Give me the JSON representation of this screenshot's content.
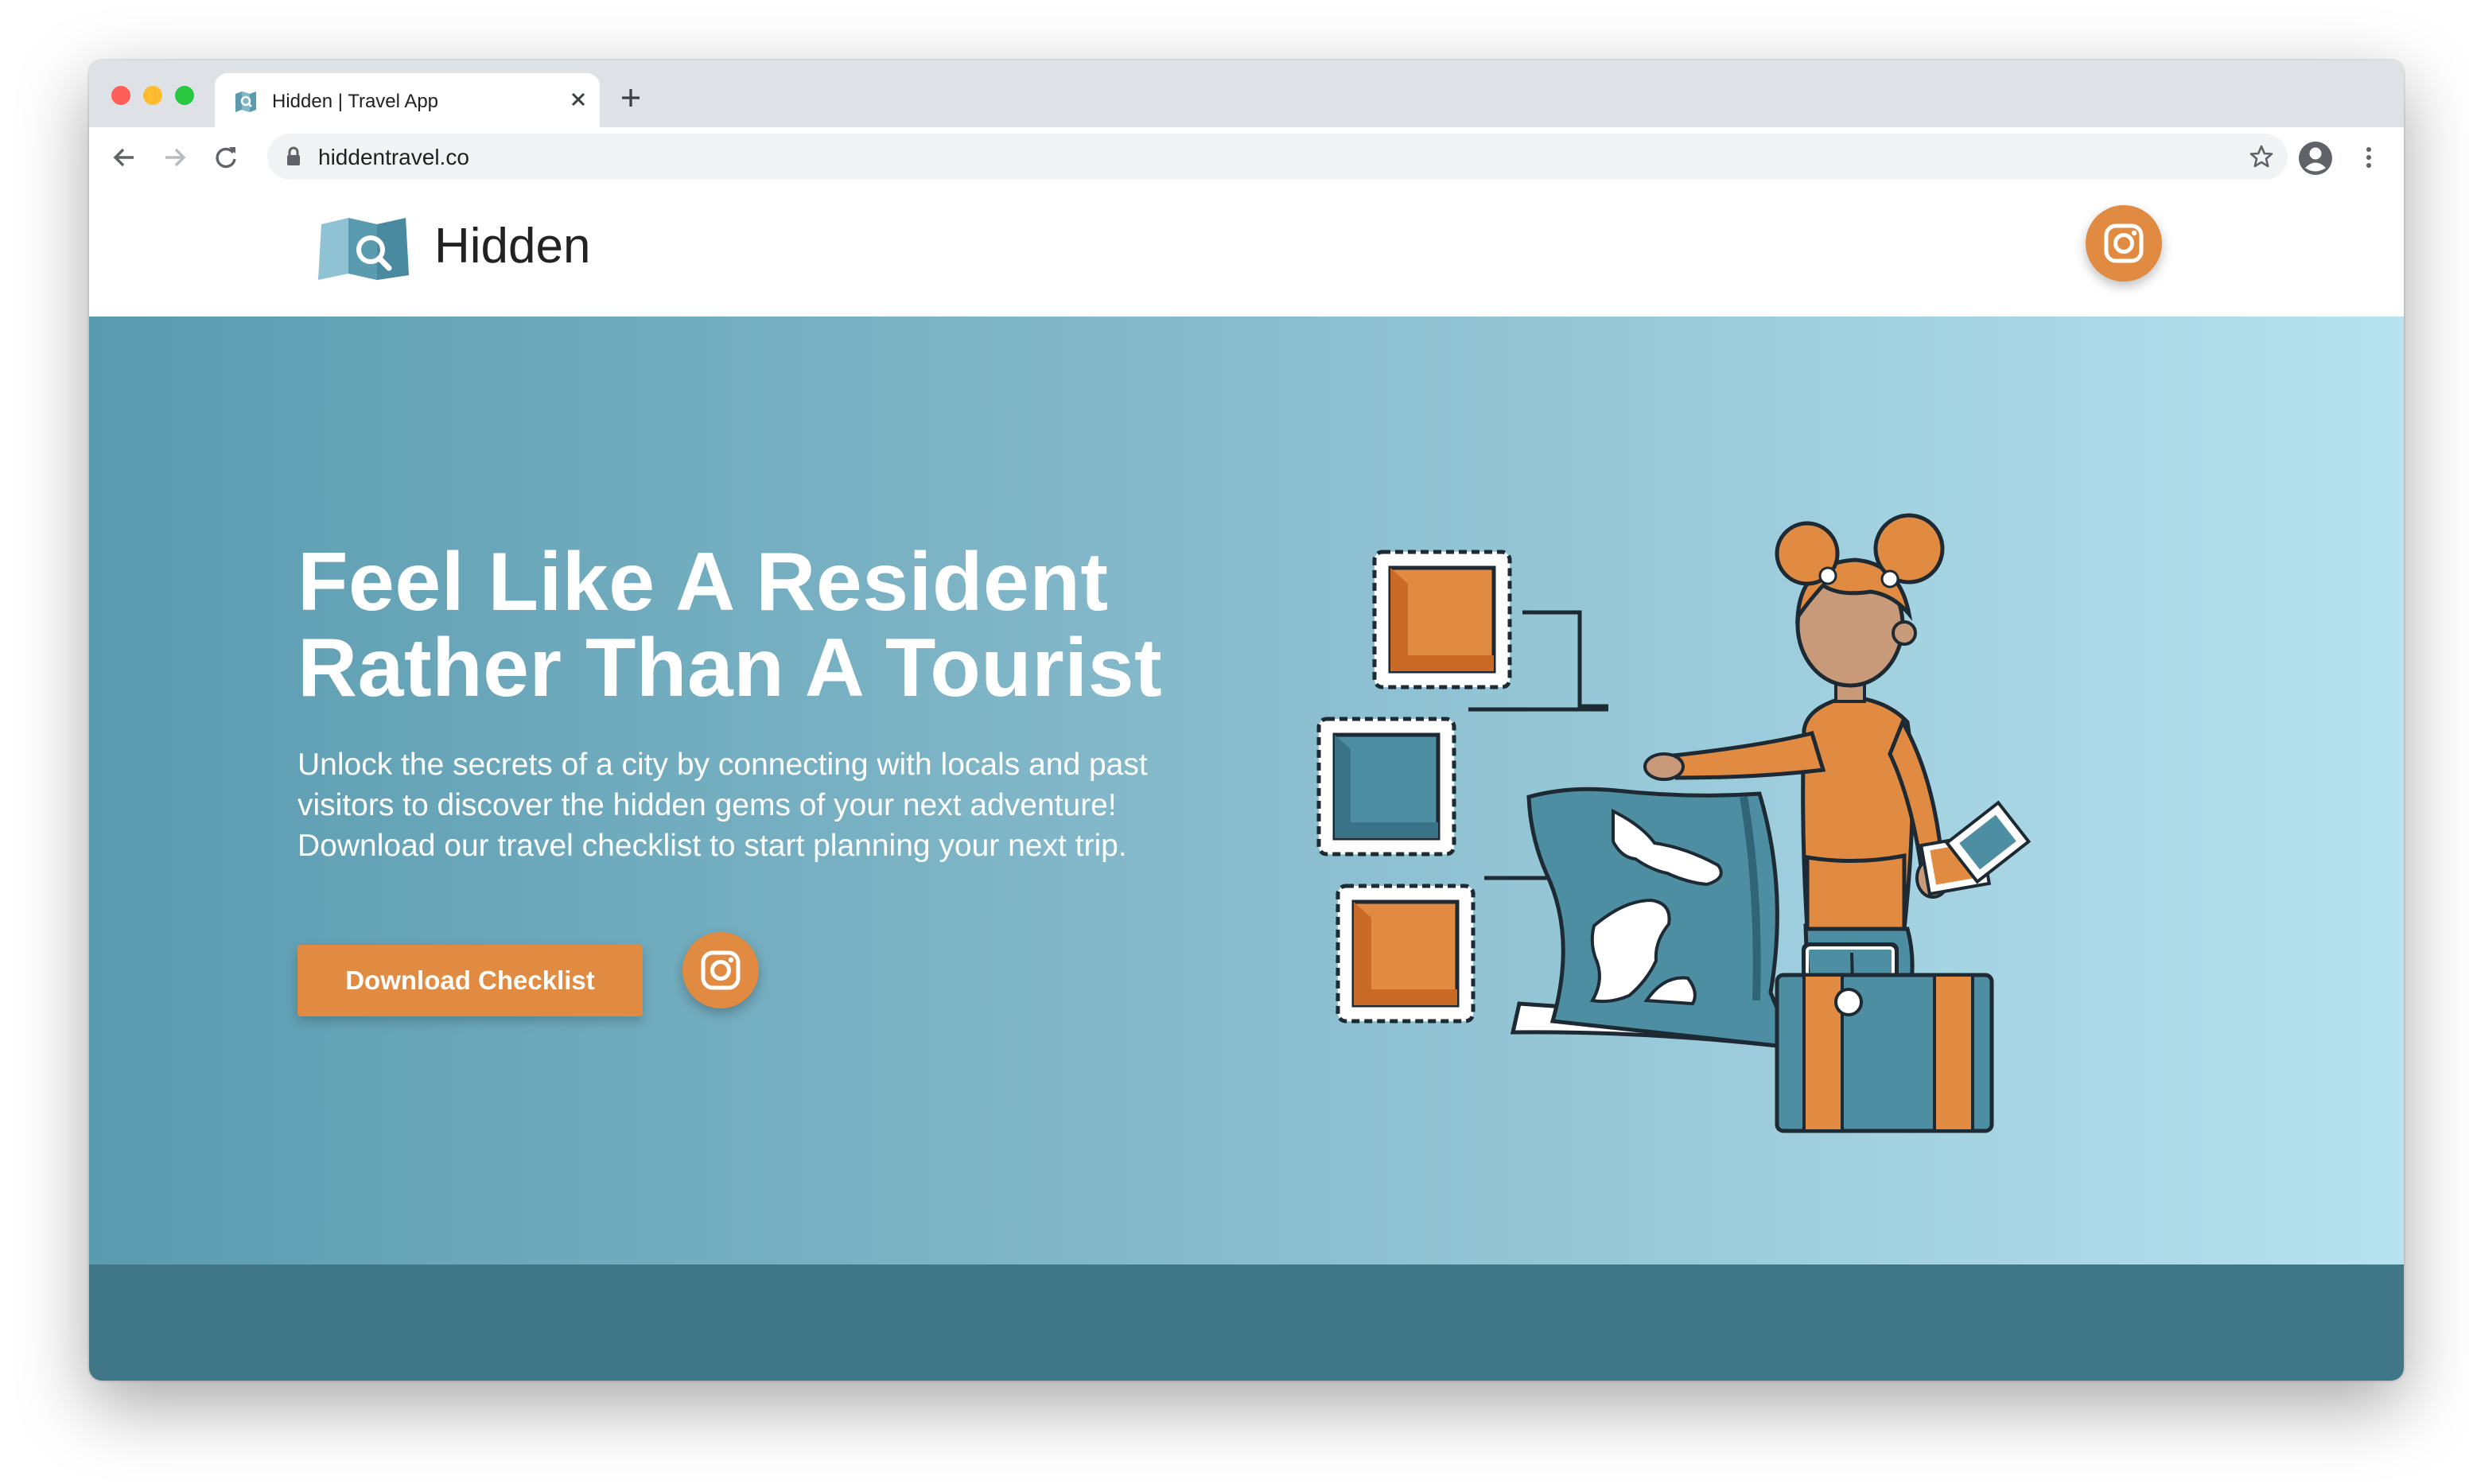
{
  "browser": {
    "tab_title": "Hidden | Travel App",
    "url": "hiddentravel.co",
    "icons": {
      "close_tab": "close-icon",
      "new_tab": "plus-icon",
      "back": "back-arrow-icon",
      "forward": "forward-arrow-icon",
      "reload": "reload-icon",
      "lock": "lock-icon",
      "bookmark": "star-icon",
      "profile": "account-icon",
      "menu": "kebab-menu-icon"
    }
  },
  "site": {
    "brand": "Hidden",
    "social_icon": "instagram-icon"
  },
  "hero": {
    "title_line1": "Feel Like A Resident",
    "title_line2": "Rather Than A Tourist",
    "subtitle": "Unlock the secrets of a city by connecting with locals and past visitors to discover the hidden gems of your next adventure! Download our travel checklist to start planning your next trip.",
    "cta_label": "Download Checklist"
  },
  "colors": {
    "accent": "#e18a41",
    "hero_gradient_start": "#5a9bb0",
    "hero_gradient_end": "#b7e2ef",
    "footer_band": "#3f7789"
  }
}
